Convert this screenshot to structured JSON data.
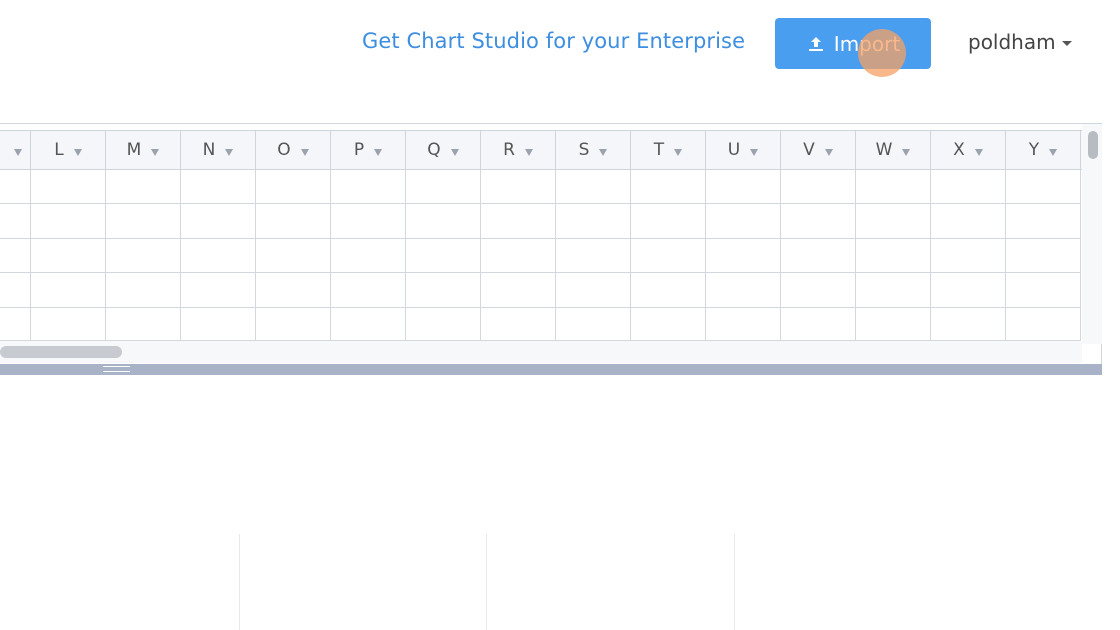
{
  "header": {
    "enterprise_link": "Get Chart Studio for your Enterprise",
    "import_label": "Import",
    "import_icon": "upload-icon",
    "user_name": "poldham",
    "accent_color": "#4a9ef0",
    "link_color": "#3d8ee0"
  },
  "grid": {
    "partial_first_column": "",
    "columns": [
      "L",
      "M",
      "N",
      "O",
      "P",
      "Q",
      "R",
      "S",
      "T",
      "U",
      "V",
      "W",
      "X",
      "Y"
    ],
    "row_count": 5
  }
}
